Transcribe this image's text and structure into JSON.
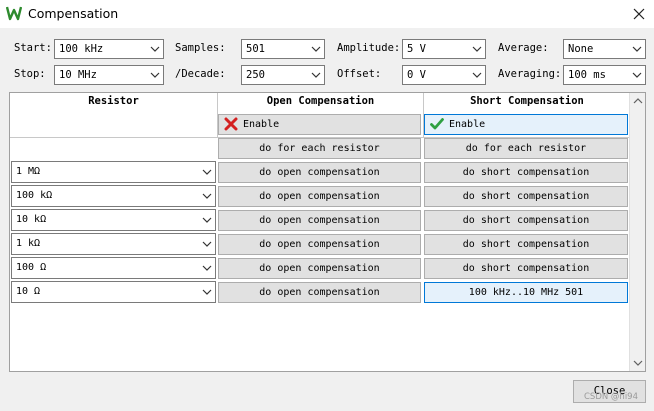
{
  "window": {
    "title": "Compensation"
  },
  "settings": {
    "start": {
      "label": "Start:",
      "value": "100 kHz"
    },
    "stop": {
      "label": "Stop:",
      "value": "10 MHz"
    },
    "samples": {
      "label": "Samples:",
      "value": "501"
    },
    "decade": {
      "label": "/Decade:",
      "value": "250"
    },
    "amplitude": {
      "label": "Amplitude:",
      "value": "5 V"
    },
    "offset": {
      "label": "Offset:",
      "value": "0 V"
    },
    "average": {
      "label": "Average:",
      "value": "None"
    },
    "averaging": {
      "label": "Averaging:",
      "value": "100 ms"
    }
  },
  "table": {
    "headers": {
      "resistor": "Resistor",
      "open": "Open Compensation",
      "short": "Short Compensation"
    },
    "open_enable": {
      "label": "Enable",
      "icon": "red-x-icon"
    },
    "short_enable": {
      "label": "Enable",
      "icon": "green-check-icon"
    },
    "open_each": "do for each resistor",
    "short_each": "do for each resistor",
    "rows": [
      {
        "resistor": "1 MΩ",
        "open": "do open compensation",
        "short": "do short compensation"
      },
      {
        "resistor": "100 kΩ",
        "open": "do open compensation",
        "short": "do short compensation"
      },
      {
        "resistor": "10 kΩ",
        "open": "do open compensation",
        "short": "do short compensation"
      },
      {
        "resistor": "1 kΩ",
        "open": "do open compensation",
        "short": "do short compensation"
      },
      {
        "resistor": "100  Ω",
        "open": "do open compensation",
        "short": "do short compensation"
      },
      {
        "resistor": "10  Ω",
        "open": "do open compensation",
        "short": "100 kHz..10 MHz 501"
      }
    ]
  },
  "footer": {
    "close_label": "Close",
    "watermark": "CSDN @hi94"
  }
}
